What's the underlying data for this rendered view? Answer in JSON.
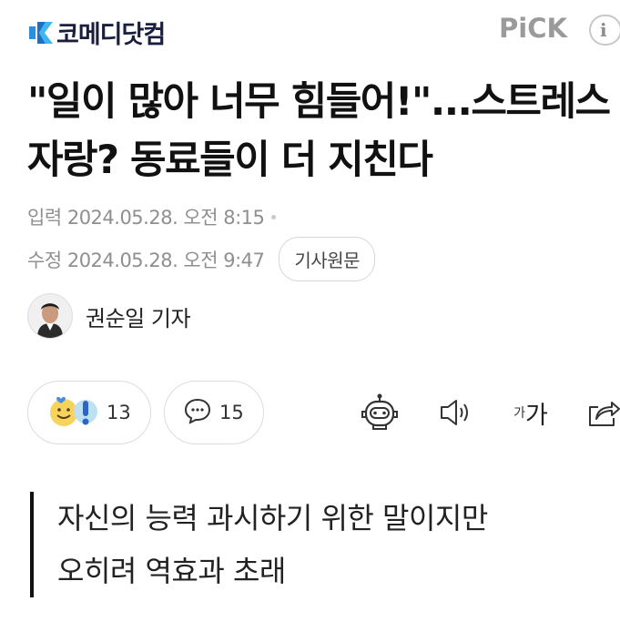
{
  "header": {
    "brand_name": "코메디닷컴",
    "brand_color": "#2a8fe0",
    "pick_label": "PiCK",
    "info_icon_text": "i"
  },
  "article": {
    "title": "\"일이 많아 너무 힘들어!\"...스트레스 자랑? 동료들이 더 지친다",
    "input_label": "입력",
    "input_date": "2024.05.28. 오전 8:15",
    "modified_label": "수정",
    "modified_date": "2024.05.28. 오전 9:47",
    "original_button": "기사원문",
    "author": "권순일 기자",
    "subheadline": [
      "자신의 능력 과시하기 위한 말이지만",
      "오히려 역효과 초래"
    ]
  },
  "actions": {
    "reaction_count": "13",
    "comment_count": "15",
    "font_size_small": "가",
    "font_size_big": "가",
    "icons": [
      "reaction-emoji-icon",
      "comment-bubble-icon",
      "bot-summary-icon",
      "speaker-icon",
      "font-size-icon",
      "share-icon"
    ]
  }
}
